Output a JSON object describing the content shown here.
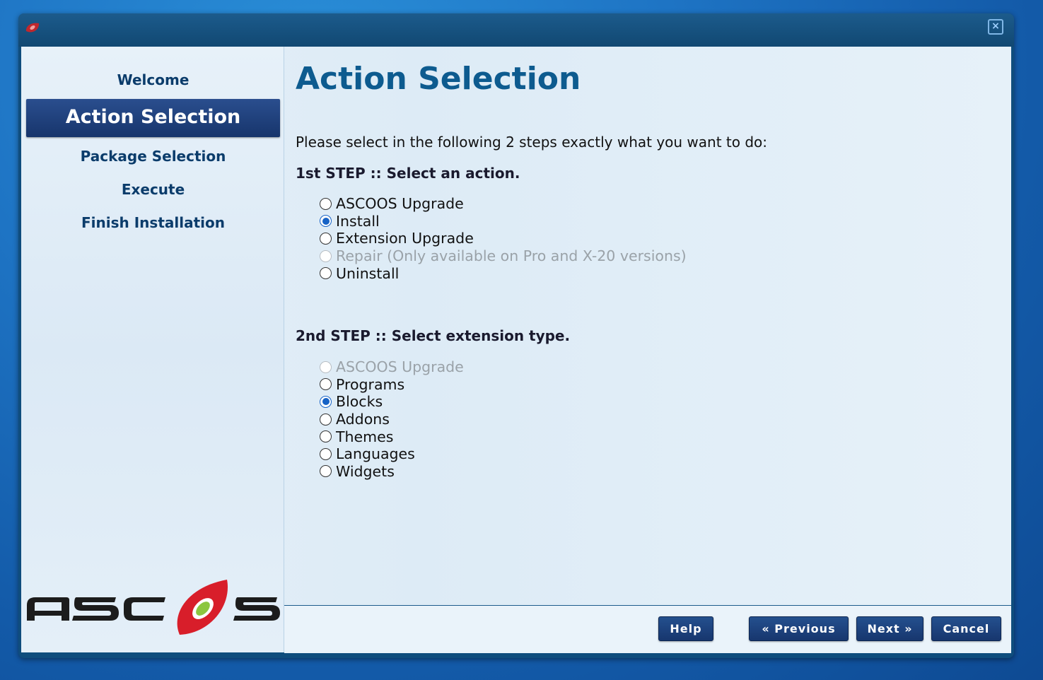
{
  "window": {
    "close_label": "×"
  },
  "sidebar": {
    "items": [
      {
        "label": "Welcome"
      },
      {
        "label": "Action Selection"
      },
      {
        "label": "Package Selection"
      },
      {
        "label": "Execute"
      },
      {
        "label": "Finish Installation"
      }
    ],
    "logo_text": "ASCOOS"
  },
  "main": {
    "title": "Action Selection",
    "intro": "Please select in the following 2 steps exactly what you want to do:",
    "step1": {
      "heading": "1st STEP :: Select an action.",
      "options": [
        {
          "label": "ASCOOS Upgrade",
          "checked": false,
          "disabled": false
        },
        {
          "label": "Install",
          "checked": true,
          "disabled": false
        },
        {
          "label": "Extension Upgrade",
          "checked": false,
          "disabled": false
        },
        {
          "label": "Repair (Only available on Pro and X-20 versions)",
          "checked": false,
          "disabled": true
        },
        {
          "label": "Uninstall",
          "checked": false,
          "disabled": false
        }
      ]
    },
    "step2": {
      "heading": "2nd STEP :: Select extension type.",
      "options": [
        {
          "label": "ASCOOS Upgrade",
          "checked": false,
          "disabled": true
        },
        {
          "label": "Programs",
          "checked": false,
          "disabled": false
        },
        {
          "label": "Blocks",
          "checked": true,
          "disabled": false
        },
        {
          "label": "Addons",
          "checked": false,
          "disabled": false
        },
        {
          "label": "Themes",
          "checked": false,
          "disabled": false
        },
        {
          "label": "Languages",
          "checked": false,
          "disabled": false
        },
        {
          "label": "Widgets",
          "checked": false,
          "disabled": false
        }
      ]
    }
  },
  "footer": {
    "help_label": "Help",
    "previous_label": "« Previous",
    "next_label": "Next »",
    "cancel_label": "Cancel"
  },
  "colors": {
    "accent": "#0d5b8f",
    "active_nav": "#1f4282",
    "radio_checked": "#1662c6",
    "logo_red": "#d81e2a",
    "logo_green": "#8cc63f"
  }
}
